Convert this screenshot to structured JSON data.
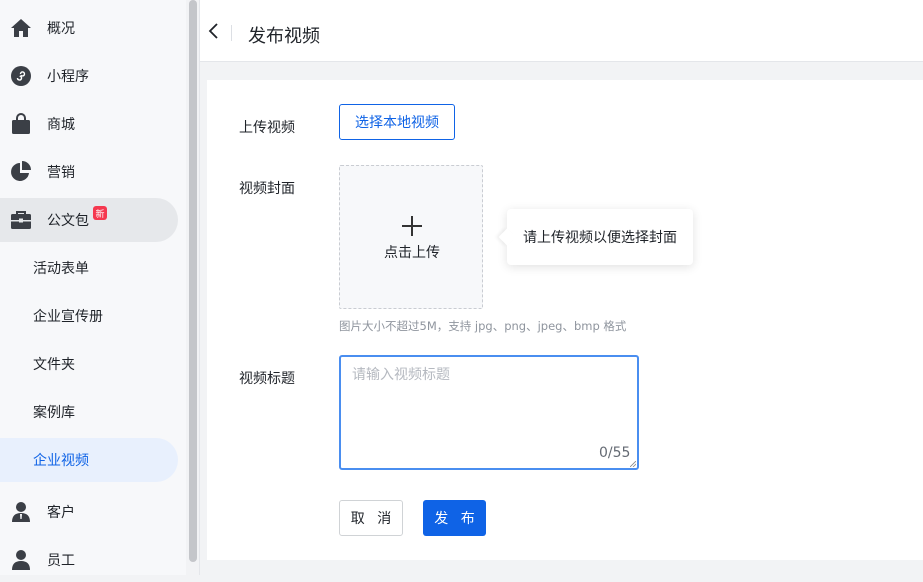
{
  "sidebar": {
    "items": [
      {
        "label": "概况",
        "icon": "home-icon"
      },
      {
        "label": "小程序",
        "icon": "mini-program-icon"
      },
      {
        "label": "商城",
        "icon": "shopping-bag-icon"
      },
      {
        "label": "营销",
        "icon": "pie-chart-icon"
      },
      {
        "label": "公文包",
        "icon": "briefcase-icon",
        "badge": "新"
      },
      {
        "label": "活动表单"
      },
      {
        "label": "企业宣传册"
      },
      {
        "label": "文件夹"
      },
      {
        "label": "案例库"
      },
      {
        "label": "企业视频"
      },
      {
        "label": "客户",
        "icon": "customer-icon"
      },
      {
        "label": "员工",
        "icon": "employee-icon"
      }
    ]
  },
  "header": {
    "title": "发布视频"
  },
  "form": {
    "upload_video_label": "上传视频",
    "select_local_video": "选择本地视频",
    "cover_label": "视频封面",
    "upload_text": "点击上传",
    "tooltip": "请上传视频以便选择封面",
    "cover_hint": "图片大小不超过5M，支持 jpg、png、jpeg、bmp 格式",
    "title_label": "视频标题",
    "title_placeholder": "请输入视频标题",
    "title_value": "",
    "counter": "0/55",
    "cancel": "取 消",
    "publish": "发 布"
  },
  "colors": {
    "primary": "#0f63e6",
    "badge": "#f5384f",
    "active_bg": "#e8f0fd"
  }
}
